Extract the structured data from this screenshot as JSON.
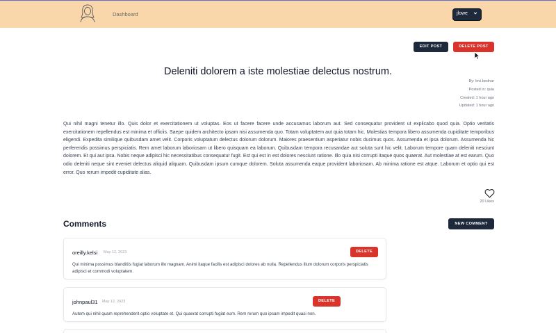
{
  "nav": {
    "logo_icon": "person-logo-icon",
    "dashboard_label": "Dashboard",
    "user_label": "jlowe"
  },
  "post": {
    "edit_label": "EDIT POST",
    "delete_label": "DELETE POST",
    "title": "Deleniti dolorem a iste molestiae delectus nostrum.",
    "by": "By: levi.bednar",
    "posted_in": "Posted in: quia",
    "created": "Created: 1 hour ago",
    "updated": "Updated: 1 hour ago",
    "body": "Qui nihil magni tenetur illo. Quis dolor et exercitationem ut voluptas. Eos ut facere facere unde accusamus laborum aut. Sed consequatur provident ut explicabo quod quia. Optio veritatis exercitationem repellendus est minima et officiis. Saepe quidem architecto ipsam nisi assumenda quo. Totam voluptatem aut quia totam hic. Molestias tempora libero assumenda cupiditate temporibus eligendi. Expedita similique quibusdam amet velit. Corporis voluptatum delectus dolorum dolorum. Maiores praesentium asperiatur nobis ducimus quos. Assumenda et ipsa dolorum. Assumenda hic perferendis possimus perspiciatis. Rem amet laborum laboriosam ut libero quisquam ea laborum. Quibusdam tempora recusandae aut soluta sunt hic velit. Laborum tempore quam deleniti nesciunt dolorem. Et qui aut ipsa. Nobis neque adipisci hic necessitatibus consequatur fugit. Est qui est in est dolores nesciunt ratione. Illo quia nisi corrupti itaque quos quaerat. Aut molestiae at est earum. Quo odio deleniti neque sint eveniet delectus aliquid aliquam. Quibusdam ipsum cumque dolorem. Soluta assumenda eaque provident laboriosam. Ab minima ratione est atque. Laborum et optio qui est error. Quo rerum impedit cupiditate alias.",
    "likes": "20 Likes"
  },
  "comments": {
    "heading": "Comments",
    "new_label": "NEW COMMENT",
    "items": [
      {
        "author": "oreilly.kelsi",
        "date": "May 12, 2023",
        "delete_label": "DELETE",
        "text": "Qui minima possimus blanditiis fugiat laborum illo magnam. Animi itaque facilis est adipisci dolores ab nulla. Repellendus illum dolorum corporis perspiciatis adipisci et commodi voluptatem."
      },
      {
        "author": "johnpaul31",
        "date": "May 12, 2023",
        "delete_label": "DELETE",
        "text": "Autem qui nihil quam reprehenderit optio voluptate et. Qui quaerat corrupti fugiat eum. Rem rerum quo ipsam impedit quasi non."
      }
    ]
  },
  "colors": {
    "navbar": "#fad7ab",
    "dark_button": "#1e2a3b",
    "danger_button": "#d9342b"
  }
}
